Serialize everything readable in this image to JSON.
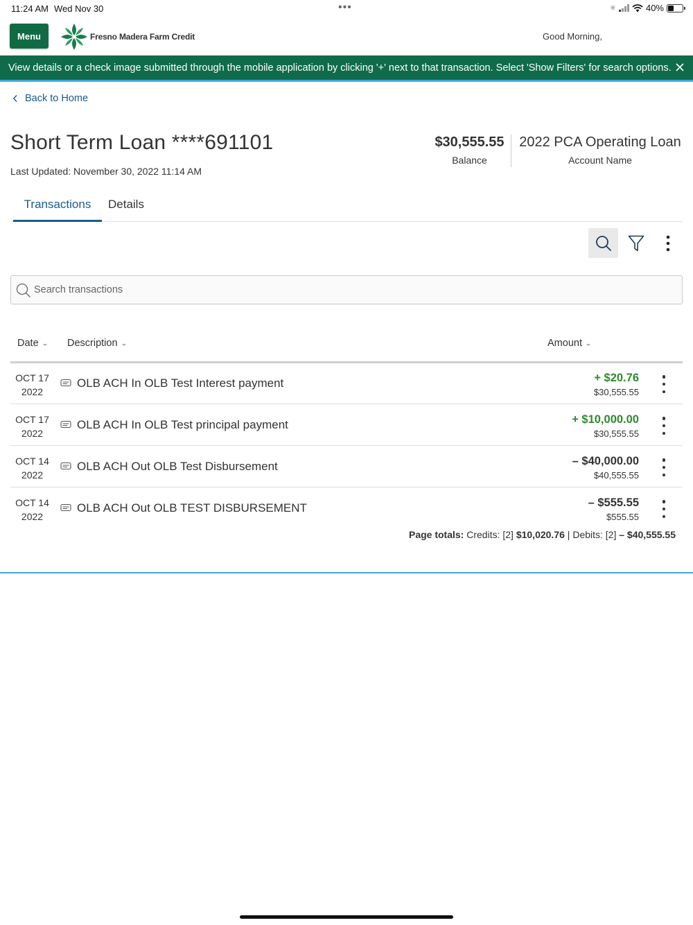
{
  "status_bar": {
    "time": "11:24 AM",
    "date": "Wed Nov 30",
    "battery": "40%"
  },
  "header": {
    "menu_label": "Menu",
    "logo_text": "Fresno Madera Farm Credit",
    "greeting": "Good Morning,"
  },
  "banner": {
    "message": "View details or a check image submitted through the mobile application by clicking '+' next to that transaction. Select 'Show Filters' for search options."
  },
  "nav": {
    "back_label": "Back to Home"
  },
  "account": {
    "title": "Short Term Loan ****691101",
    "last_updated": "Last Updated: November 30, 2022 11:14 AM",
    "balance_value": "$30,555.55",
    "balance_label": "Balance",
    "name_value": "2022 PCA Operating Loan",
    "name_label": "Account Name"
  },
  "tabs": [
    {
      "label": "Transactions",
      "active": true
    },
    {
      "label": "Details",
      "active": false
    }
  ],
  "search": {
    "placeholder": "Search transactions"
  },
  "table": {
    "columns": {
      "date": "Date",
      "description": "Description",
      "amount": "Amount"
    },
    "rows": [
      {
        "month_day": "OCT 17",
        "year": "2022",
        "description": "OLB ACH In OLB Test Interest payment",
        "amount": "+ $20.76",
        "type": "credit",
        "running_balance": "$30,555.55"
      },
      {
        "month_day": "OCT 17",
        "year": "2022",
        "description": "OLB ACH In OLB Test principal payment",
        "amount": "+ $10,000.00",
        "type": "credit",
        "running_balance": "$30,555.55"
      },
      {
        "month_day": "OCT 14",
        "year": "2022",
        "description": "OLB ACH Out OLB Test Disbursement",
        "amount": "– $40,000.00",
        "type": "debit",
        "running_balance": "$40,555.55"
      },
      {
        "month_day": "OCT 14",
        "year": "2022",
        "description": "OLB ACH Out OLB TEST DISBURSEMENT",
        "amount": "– $555.55",
        "type": "debit",
        "running_balance": "$555.55"
      }
    ]
  },
  "totals": {
    "label": "Page totals:",
    "credits_label": "Credits: [2]",
    "credits_value": "$10,020.76",
    "separator": "|",
    "debits_label": "Debits: [2]",
    "debits_value": "– $40,555.55"
  },
  "colors": {
    "brand_green": "#106b45",
    "banner_green": "#0f6b4a",
    "accent_blue": "#1a5a8a",
    "credit_green": "#2e8b2e",
    "rule_blue": "#3fa8d8"
  }
}
